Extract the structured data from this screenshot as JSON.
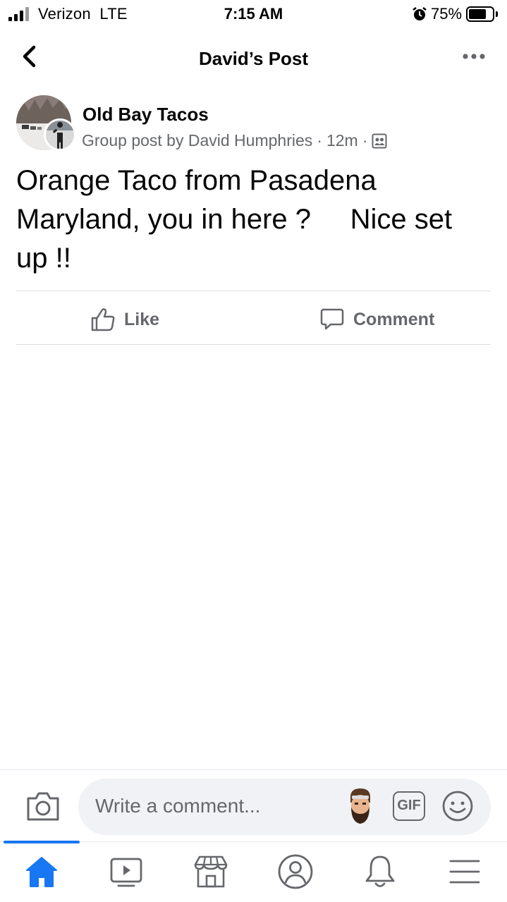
{
  "status_bar": {
    "carrier": "Verizon  LTE",
    "time": "7:15 AM",
    "battery_percent": "75%",
    "battery_level": 0.75
  },
  "header": {
    "title": "David’s Post"
  },
  "post": {
    "group_name": "Old Bay Tacos",
    "meta_prefix": "Group post by David Humphries",
    "meta_dot": "·",
    "time_ago": "12m",
    "body": "Orange Taco from Pasadena\nMaryland, you in here ?     Nice set\nup !!"
  },
  "actions": {
    "like_label": "Like",
    "comment_label": "Comment"
  },
  "composer": {
    "placeholder": "Write a comment...",
    "gif_label": "GIF"
  },
  "colors": {
    "accent": "#1877f2",
    "secondary_text": "#65676b",
    "divider": "#dadde1"
  },
  "nav": {
    "items": [
      "home-icon",
      "watch-icon",
      "marketplace-icon",
      "profile-icon",
      "notifications-icon",
      "menu-icon"
    ],
    "active": "home-icon"
  }
}
